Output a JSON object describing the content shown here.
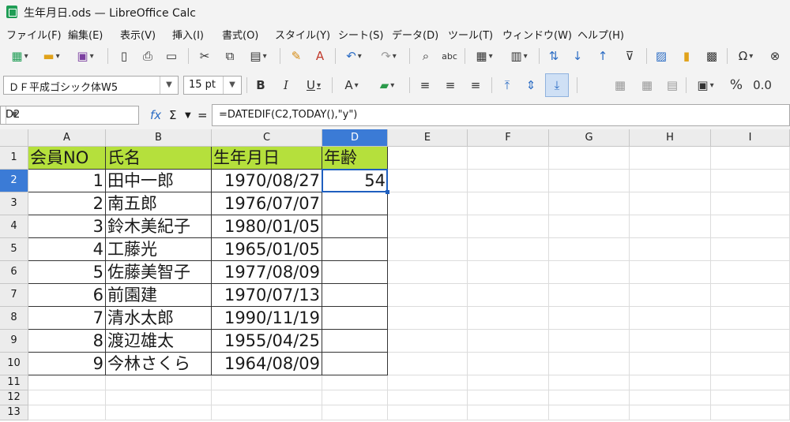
{
  "window": {
    "title": "生年月日.ods — LibreOffice Calc"
  },
  "menu": [
    "ファイル(F)",
    "編集(E)",
    "表示(V)",
    "挿入(I)",
    "書式(O)",
    "スタイル(Y)",
    "シート(S)",
    "データ(D)",
    "ツール(T)",
    "ウィンドウ(W)",
    "ヘルプ(H)"
  ],
  "format_bar": {
    "font_name": "ＤＦ平成ゴシック体W5",
    "font_size": "15 pt",
    "bold": "B",
    "italic": "I",
    "underline": "U",
    "font_color_glyph": "A",
    "percent": "%",
    "decimal": "0.0"
  },
  "formula_bar": {
    "name_box": "D2",
    "fx": "fx",
    "sum": "Σ",
    "equals": "=",
    "formula": "=DATEDIF(C2,TODAY(),\"y\")"
  },
  "sheet": {
    "columns": [
      "A",
      "B",
      "C",
      "D",
      "E",
      "F",
      "G",
      "H",
      "I"
    ],
    "rows": [
      "1",
      "2",
      "3",
      "4",
      "5",
      "6",
      "7",
      "8",
      "9",
      "10",
      "11",
      "12",
      "13"
    ],
    "active_cell": "D2",
    "header_fill": "#b5e03c",
    "header_row": [
      "会員NO",
      "氏名",
      "生年月日",
      "年齢"
    ],
    "data": [
      [
        "1",
        "田中一郎",
        "1970/08/27",
        "54"
      ],
      [
        "2",
        "南五郎",
        "1976/07/07",
        ""
      ],
      [
        "3",
        "鈴木美紀子",
        "1980/01/05",
        ""
      ],
      [
        "4",
        "工藤光",
        "1965/01/05",
        ""
      ],
      [
        "5",
        "佐藤美智子",
        "1977/08/09",
        ""
      ],
      [
        "6",
        "前園建",
        "1970/07/13",
        ""
      ],
      [
        "7",
        "清水太郎",
        "1990/11/19",
        ""
      ],
      [
        "8",
        "渡辺雄太",
        "1955/04/25",
        ""
      ],
      [
        "9",
        "今林さくら",
        "1964/08/09",
        ""
      ]
    ]
  }
}
